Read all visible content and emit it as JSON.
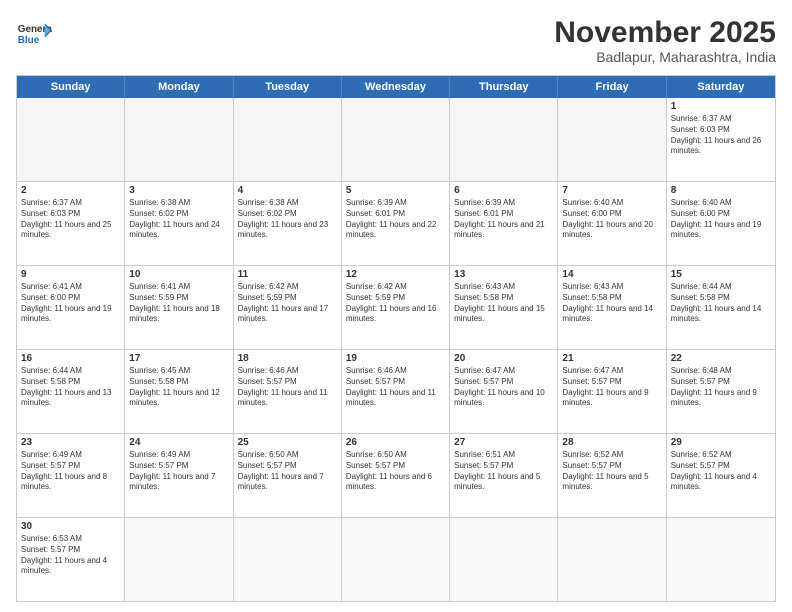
{
  "header": {
    "logo_general": "General",
    "logo_blue": "Blue",
    "month_title": "November 2025",
    "location": "Badlapur, Maharashtra, India"
  },
  "days_of_week": [
    "Sunday",
    "Monday",
    "Tuesday",
    "Wednesday",
    "Thursday",
    "Friday",
    "Saturday"
  ],
  "rows": [
    {
      "cells": [
        {
          "day": "",
          "empty": true
        },
        {
          "day": "",
          "empty": true
        },
        {
          "day": "",
          "empty": true
        },
        {
          "day": "",
          "empty": true
        },
        {
          "day": "",
          "empty": true
        },
        {
          "day": "",
          "empty": true
        },
        {
          "day": "1",
          "sunrise": "Sunrise: 6:37 AM",
          "sunset": "Sunset: 6:03 PM",
          "daylight": "Daylight: 11 hours and 26 minutes."
        }
      ]
    },
    {
      "cells": [
        {
          "day": "2",
          "sunrise": "Sunrise: 6:37 AM",
          "sunset": "Sunset: 6:03 PM",
          "daylight": "Daylight: 11 hours and 25 minutes."
        },
        {
          "day": "3",
          "sunrise": "Sunrise: 6:38 AM",
          "sunset": "Sunset: 6:02 PM",
          "daylight": "Daylight: 11 hours and 24 minutes."
        },
        {
          "day": "4",
          "sunrise": "Sunrise: 6:38 AM",
          "sunset": "Sunset: 6:02 PM",
          "daylight": "Daylight: 11 hours and 23 minutes."
        },
        {
          "day": "5",
          "sunrise": "Sunrise: 6:39 AM",
          "sunset": "Sunset: 6:01 PM",
          "daylight": "Daylight: 11 hours and 22 minutes."
        },
        {
          "day": "6",
          "sunrise": "Sunrise: 6:39 AM",
          "sunset": "Sunset: 6:01 PM",
          "daylight": "Daylight: 11 hours and 21 minutes."
        },
        {
          "day": "7",
          "sunrise": "Sunrise: 6:40 AM",
          "sunset": "Sunset: 6:00 PM",
          "daylight": "Daylight: 11 hours and 20 minutes."
        },
        {
          "day": "8",
          "sunrise": "Sunrise: 6:40 AM",
          "sunset": "Sunset: 6:00 PM",
          "daylight": "Daylight: 11 hours and 19 minutes."
        }
      ]
    },
    {
      "cells": [
        {
          "day": "9",
          "sunrise": "Sunrise: 6:41 AM",
          "sunset": "Sunset: 6:00 PM",
          "daylight": "Daylight: 11 hours and 19 minutes."
        },
        {
          "day": "10",
          "sunrise": "Sunrise: 6:41 AM",
          "sunset": "Sunset: 5:59 PM",
          "daylight": "Daylight: 11 hours and 18 minutes."
        },
        {
          "day": "11",
          "sunrise": "Sunrise: 6:42 AM",
          "sunset": "Sunset: 5:59 PM",
          "daylight": "Daylight: 11 hours and 17 minutes."
        },
        {
          "day": "12",
          "sunrise": "Sunrise: 6:42 AM",
          "sunset": "Sunset: 5:59 PM",
          "daylight": "Daylight: 11 hours and 16 minutes."
        },
        {
          "day": "13",
          "sunrise": "Sunrise: 6:43 AM",
          "sunset": "Sunset: 5:58 PM",
          "daylight": "Daylight: 11 hours and 15 minutes."
        },
        {
          "day": "14",
          "sunrise": "Sunrise: 6:43 AM",
          "sunset": "Sunset: 5:58 PM",
          "daylight": "Daylight: 11 hours and 14 minutes."
        },
        {
          "day": "15",
          "sunrise": "Sunrise: 6:44 AM",
          "sunset": "Sunset: 5:58 PM",
          "daylight": "Daylight: 11 hours and 14 minutes."
        }
      ]
    },
    {
      "cells": [
        {
          "day": "16",
          "sunrise": "Sunrise: 6:44 AM",
          "sunset": "Sunset: 5:58 PM",
          "daylight": "Daylight: 11 hours and 13 minutes."
        },
        {
          "day": "17",
          "sunrise": "Sunrise: 6:45 AM",
          "sunset": "Sunset: 5:58 PM",
          "daylight": "Daylight: 11 hours and 12 minutes."
        },
        {
          "day": "18",
          "sunrise": "Sunrise: 6:46 AM",
          "sunset": "Sunset: 5:57 PM",
          "daylight": "Daylight: 11 hours and 11 minutes."
        },
        {
          "day": "19",
          "sunrise": "Sunrise: 6:46 AM",
          "sunset": "Sunset: 5:57 PM",
          "daylight": "Daylight: 11 hours and 11 minutes."
        },
        {
          "day": "20",
          "sunrise": "Sunrise: 6:47 AM",
          "sunset": "Sunset: 5:57 PM",
          "daylight": "Daylight: 11 hours and 10 minutes."
        },
        {
          "day": "21",
          "sunrise": "Sunrise: 6:47 AM",
          "sunset": "Sunset: 5:57 PM",
          "daylight": "Daylight: 11 hours and 9 minutes."
        },
        {
          "day": "22",
          "sunrise": "Sunrise: 6:48 AM",
          "sunset": "Sunset: 5:57 PM",
          "daylight": "Daylight: 11 hours and 9 minutes."
        }
      ]
    },
    {
      "cells": [
        {
          "day": "23",
          "sunrise": "Sunrise: 6:49 AM",
          "sunset": "Sunset: 5:57 PM",
          "daylight": "Daylight: 11 hours and 8 minutes."
        },
        {
          "day": "24",
          "sunrise": "Sunrise: 6:49 AM",
          "sunset": "Sunset: 5:57 PM",
          "daylight": "Daylight: 11 hours and 7 minutes."
        },
        {
          "day": "25",
          "sunrise": "Sunrise: 6:50 AM",
          "sunset": "Sunset: 5:57 PM",
          "daylight": "Daylight: 11 hours and 7 minutes."
        },
        {
          "day": "26",
          "sunrise": "Sunrise: 6:50 AM",
          "sunset": "Sunset: 5:57 PM",
          "daylight": "Daylight: 11 hours and 6 minutes."
        },
        {
          "day": "27",
          "sunrise": "Sunrise: 6:51 AM",
          "sunset": "Sunset: 5:57 PM",
          "daylight": "Daylight: 11 hours and 5 minutes."
        },
        {
          "day": "28",
          "sunrise": "Sunrise: 6:52 AM",
          "sunset": "Sunset: 5:57 PM",
          "daylight": "Daylight: 11 hours and 5 minutes."
        },
        {
          "day": "29",
          "sunrise": "Sunrise: 6:52 AM",
          "sunset": "Sunset: 5:57 PM",
          "daylight": "Daylight: 11 hours and 4 minutes."
        }
      ]
    },
    {
      "cells": [
        {
          "day": "30",
          "sunrise": "Sunrise: 6:53 AM",
          "sunset": "Sunset: 5:57 PM",
          "daylight": "Daylight: 11 hours and 4 minutes."
        },
        {
          "day": "",
          "empty": true
        },
        {
          "day": "",
          "empty": true
        },
        {
          "day": "",
          "empty": true
        },
        {
          "day": "",
          "empty": true
        },
        {
          "day": "",
          "empty": true
        },
        {
          "day": "",
          "empty": true
        }
      ]
    }
  ]
}
